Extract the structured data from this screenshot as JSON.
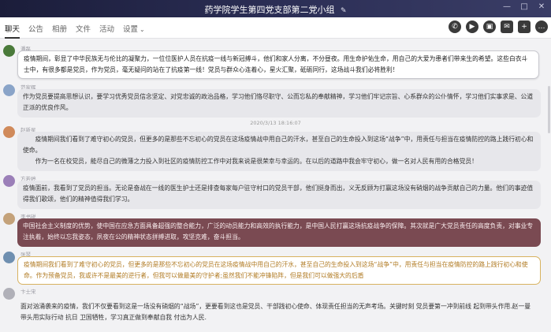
{
  "window": {
    "title": "药学院学生第四党支部第二党小组",
    "right_controls": [
      "—",
      "□",
      "✕"
    ]
  },
  "tabs": [
    {
      "label": "聊天"
    },
    {
      "label": "公告"
    },
    {
      "label": "相册"
    },
    {
      "label": "文件"
    },
    {
      "label": "活动"
    },
    {
      "label": "设置"
    }
  ],
  "toolbar": {
    "icons": [
      "phone-icon",
      "video-icon",
      "screen-share-icon",
      "message-icon",
      "add-member-icon",
      "more-icon"
    ],
    "glyphs": [
      "✆",
      "▶",
      "▣",
      "✉",
      "+",
      "…"
    ]
  },
  "timestamp": "2020/3/13 18:16:07",
  "messages": [
    {
      "sender": "潘磊",
      "lines": [
        "疫情期间，彰显了中华民族无与伦比的凝聚力，一位位医护人员在抗疫一线与新冠搏斗，他们和家人分离，不分昼夜。用生命护佑生命，用自己的大爱为患者们带来生的希望。这些白衣斗士中，有很多都是党员，作为党员，毫无疑问的站在了抗疫第一线！党员与群众心连着心，星火汇聚，砥砺同行，这场战斗我们必将胜利！"
      ]
    },
    {
      "sender": "范家辉",
      "lines": [
        "作为党员要提高思想认识，要学习优秀党员信念坚定、对党忠诚的政治品格，学习他们恪尽职守、公而忘私的奉献精神，学习他们牢记宗旨、心系群众的公仆情怀，学习他们实事求是、公道正派的优良作风。"
      ]
    },
    {
      "sender": "赵新星",
      "lines": [
        "疫情期间我们看到了难守初心的党员，但更多的是那些不忘初心的党员在这场疫情战中用自己的汗水，甚至自己的生命投入到这场“战争”中，用责任与担当在疫情防控的路上践行初心和使命。",
        "作为一名在校党员，能尽自己的微薄之力投入到社区的疫情防控工作中对我来说是很荣幸与幸运的。在以后的道路中我会牢守初心，做一名对人民有用的合格党员！"
      ]
    },
    {
      "sender": "方若婷",
      "lines": [
        "疫情面前，我看到了党员的担当。无论是奋战在一线的医生护士还是排查每家每户驻守村口的党员干部，他们挺身而出，义无反顾为打赢这场没有硝烟的战争贡献自己的力量。他们的事迹值得我们歌颂，他们的精神值得我们学习。"
      ]
    },
    {
      "sender": "李书锐",
      "lines": [
        "中国社会主义制度的优势，使中国在应急方面具备超强的整合能力，广泛的动员能力和高效的执行能力，是中国人民打赢这场抗疫战争的保障。其次就是广大党员责任的高度负责，对事业专注执着，始终以忘我姿态，夙夜在公的精神状态拼搏进取，攻坚克难，奋斗担当。"
      ]
    },
    {
      "sender": "张琴",
      "lines": [
        "疫情期间我们看到了难守初心的党员，但更多的是那些不忘初心的党员在这场疫情战中用自己的汗水，甚至自己的生命投入到这场“战争”中，用责任与担当在疫情防控的路上践行初心和使命。作为预备党员，我或许不是最美的逆行者，但我可以做最美的守护者;虽然我们不能冲锋陷阵，但是我们可以做强大的后盾"
      ]
    },
    {
      "sender": "卞士宋",
      "lines": [
        "面对汹涌袭来的疫情，我们不仅要看到这是一场没有硝烟的“战场”，更要看到这也是党员、干部践初心使命、体现责任担当的无声考场。关键时刻 党员要第一冲到前线 起到带头作用.赵一曼带头用实际行动 抗日 卫国牺牲，学习真正做到奉献自我 付出为人民."
      ]
    }
  ],
  "colors": {
    "titlebar": "#1b1d3a",
    "maroon_bubble": "#7a4a52",
    "gold_border": "#d8b25f"
  }
}
